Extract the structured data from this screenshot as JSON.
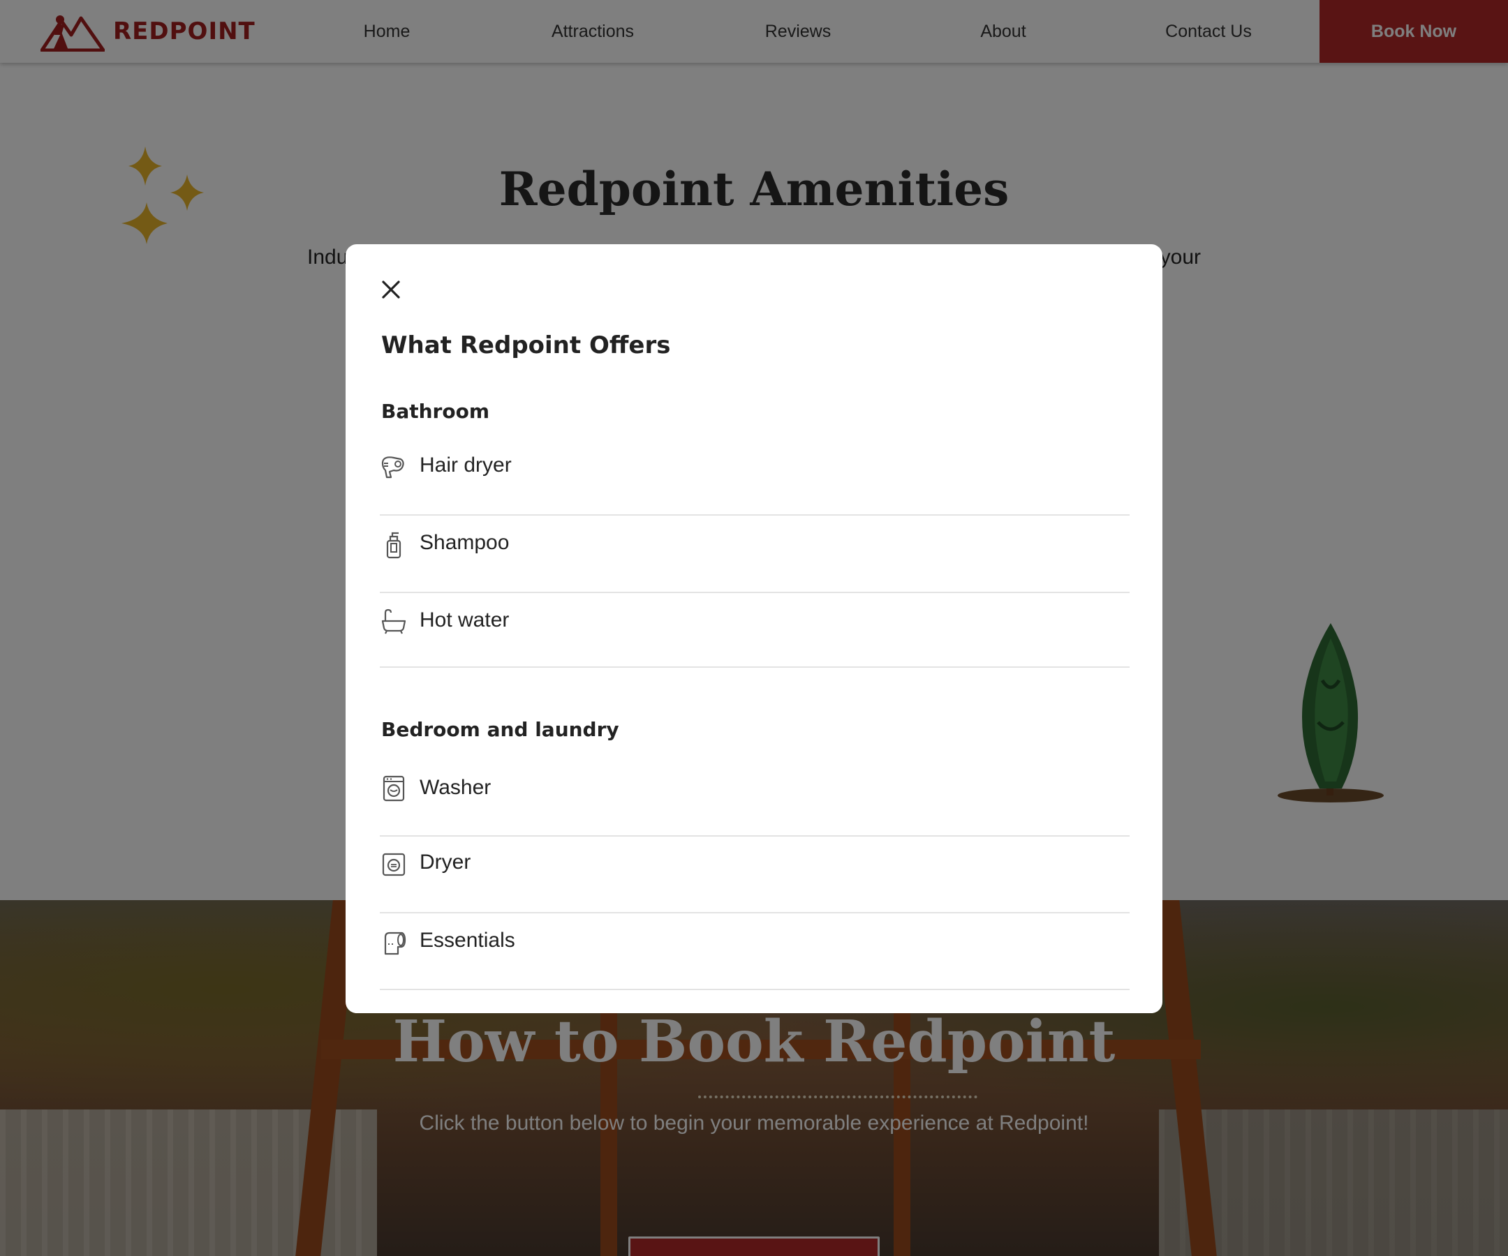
{
  "brand": {
    "name": "REDPOINT",
    "color": "#a31f1f"
  },
  "nav": {
    "items": [
      {
        "label": "Home"
      },
      {
        "label": "Attractions"
      },
      {
        "label": "Reviews"
      },
      {
        "label": "About"
      },
      {
        "label": "Contact Us"
      }
    ],
    "cta_label": "Book Now",
    "cta_color": "#b32828"
  },
  "amenities_section": {
    "title": "Redpoint Amenities",
    "subtitle_left": "Indu",
    "subtitle_right": "your"
  },
  "booking_section": {
    "title": "How to Book Redpoint",
    "subtitle": "Click the button below to begin your memorable experience at Redpoint!"
  },
  "modal": {
    "title": "What Redpoint Offers",
    "close_icon": "close-icon",
    "categories": [
      {
        "heading": "Bathroom",
        "items": [
          {
            "label": "Hair dryer",
            "icon": "hair-dryer-icon"
          },
          {
            "label": "Shampoo",
            "icon": "shampoo-icon"
          },
          {
            "label": "Hot water",
            "icon": "bathtub-icon"
          }
        ]
      },
      {
        "heading": "Bedroom and laundry",
        "items": [
          {
            "label": "Washer",
            "icon": "washer-icon"
          },
          {
            "label": "Dryer",
            "icon": "dryer-icon"
          },
          {
            "label": "Essentials",
            "icon": "toilet-paper-icon"
          }
        ]
      }
    ]
  },
  "colors": {
    "overlay": "rgba(0,0,0,0.5)",
    "sparkle": "#e8b52a",
    "icon_stroke": "#555555"
  }
}
